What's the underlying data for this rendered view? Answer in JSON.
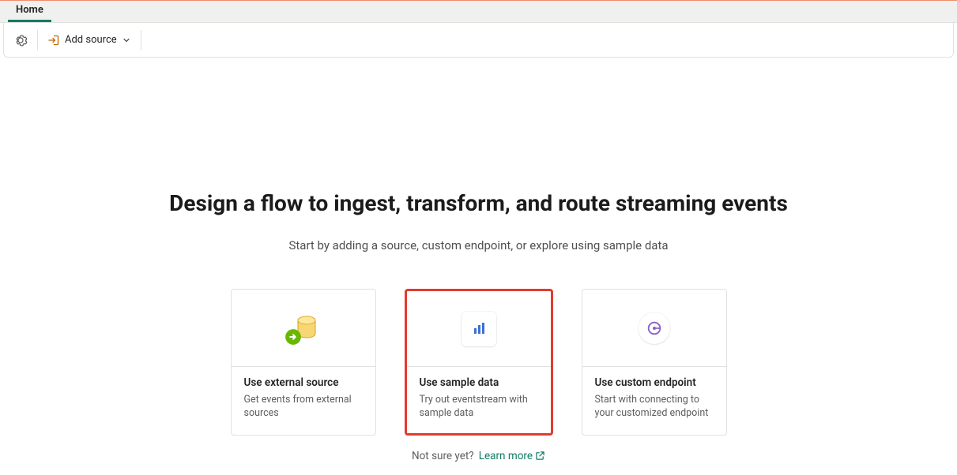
{
  "ribbon": {
    "tab": "Home",
    "add_source_label": "Add source"
  },
  "hero": {
    "title": "Design a flow to ingest, transform, and route streaming events",
    "subtitle": "Start by adding a source, custom endpoint, or explore using sample data"
  },
  "cards": [
    {
      "title": "Use external source",
      "desc": "Get events from external sources"
    },
    {
      "title": "Use sample data",
      "desc": "Try out eventstream with sample data",
      "highlight": true
    },
    {
      "title": "Use custom endpoint",
      "desc": "Start with connecting to your customized endpoint"
    }
  ],
  "footer": {
    "not_sure": "Not sure yet?",
    "learn_more": "Learn more"
  }
}
